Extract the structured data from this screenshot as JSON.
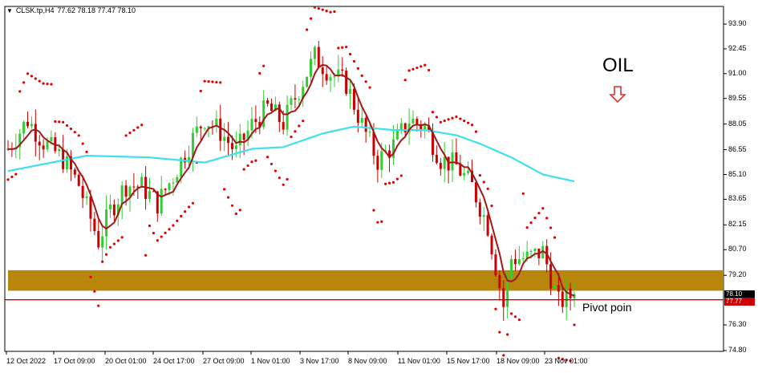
{
  "header": {
    "menu_icon": "triangle-down-icon",
    "symbol": "CLSK.tp,H4",
    "ohlc": "77.62 78.18 77.47 78.10"
  },
  "annotations": {
    "title": "OIL",
    "arrow_icon": "down-arrow-icon",
    "pivot_label": "Pivot poin"
  },
  "colors": {
    "bull": "#32cd32",
    "bear": "#cc0000",
    "sar": "#e00000",
    "ma_slow": "#3ee0ee",
    "ma_fast": "#a01818",
    "zone": "#b8860b",
    "pivot_line": "#cc0000"
  },
  "price_tags": {
    "current": "78.10",
    "pivot": "77.77"
  },
  "axis": {
    "y_ticks": [
      "93.90",
      "92.45",
      "91.00",
      "89.55",
      "88.05",
      "86.55",
      "85.10",
      "83.65",
      "82.15",
      "80.70",
      "79.20",
      "76.30",
      "74.80"
    ],
    "x_ticks": [
      "12 Oct 2022",
      "17 Oct 09:00",
      "20 Oct 01:00",
      "24 Oct 17:00",
      "27 Oct 09:00",
      "1 Nov 01:00",
      "3 Nov 17:00",
      "8 Nov 09:00",
      "11 Nov 01:00",
      "15 Nov 17:00",
      "18 Nov 09:00",
      "23 Nov 01:00"
    ]
  },
  "chart_data": {
    "type": "candlestick",
    "x_range": [
      "12 Oct 2022",
      "23 Nov 01:00"
    ],
    "ylim": [
      74.8,
      94.6
    ],
    "support_zone": [
      78.3,
      79.5
    ],
    "pivot": 77.77,
    "current_close": 78.1,
    "price_path": [
      [
        0,
        86.6
      ],
      [
        5,
        88.3
      ],
      [
        9,
        87.0
      ],
      [
        14,
        86.0
      ],
      [
        18,
        84.5
      ],
      [
        23,
        81.2
      ],
      [
        26,
        83.0
      ],
      [
        30,
        84.5
      ],
      [
        34,
        84.4
      ],
      [
        38,
        83.4
      ],
      [
        42,
        85.0
      ],
      [
        46,
        86.8
      ],
      [
        50,
        88.4
      ],
      [
        54,
        87.6
      ],
      [
        58,
        86.4
      ],
      [
        62,
        88.0
      ],
      [
        66,
        89.0
      ],
      [
        70,
        88.1
      ],
      [
        74,
        90.1
      ],
      [
        78,
        92.0
      ],
      [
        82,
        91.0
      ],
      [
        86,
        90.4
      ],
      [
        90,
        88.0
      ],
      [
        94,
        85.9
      ],
      [
        98,
        86.8
      ],
      [
        102,
        88.3
      ],
      [
        106,
        87.9
      ],
      [
        110,
        86.0
      ],
      [
        114,
        85.6
      ],
      [
        118,
        84.4
      ],
      [
        122,
        82.1
      ],
      [
        126,
        77.4
      ],
      [
        128,
        80.2
      ],
      [
        132,
        80.2
      ],
      [
        136,
        80.6
      ],
      [
        140,
        77.6
      ],
      [
        144,
        78.1
      ]
    ],
    "ma_slow": [
      [
        0,
        85.3
      ],
      [
        20,
        86.2
      ],
      [
        36,
        86.1
      ],
      [
        50,
        85.8
      ],
      [
        62,
        86.6
      ],
      [
        70,
        86.7
      ],
      [
        80,
        87.5
      ],
      [
        88,
        87.9
      ],
      [
        98,
        87.7
      ],
      [
        106,
        87.7
      ],
      [
        114,
        87.4
      ],
      [
        120,
        86.9
      ],
      [
        128,
        86.1
      ],
      [
        136,
        85.1
      ],
      [
        144,
        84.7
      ]
    ],
    "sar_dots": "parabolic SAR above price in downtrends, below price in uptrends"
  }
}
